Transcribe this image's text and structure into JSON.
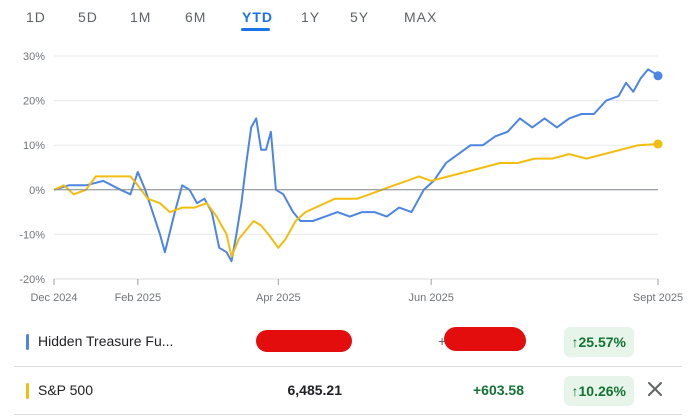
{
  "range_tabs": [
    "1D",
    "5D",
    "1M",
    "6M",
    "YTD",
    "1Y",
    "5Y",
    "MAX"
  ],
  "active_tab": "YTD",
  "colors": {
    "fund": "#4c85e6",
    "sp500": "#f3bd0e",
    "accent": "#1a73e8",
    "gain": "#137333",
    "gain_bg": "#e6f4ea",
    "redaction": "#e30d0d"
  },
  "chart_data": {
    "type": "line",
    "y_ticks": [
      "30%",
      "20%",
      "10%",
      "0%",
      "-10%",
      "-20%"
    ],
    "x_ticks": [
      "Dec 2024",
      "Feb 2025",
      "Apr 2025",
      "Jun 2025",
      "Sept 2025"
    ],
    "x_tick_dates": [
      "2024-12-31",
      "2025-02-03",
      "2025-04-01",
      "2025-06-02",
      "2025-09-02"
    ],
    "xlim": [
      "2024-12-31",
      "2025-09-02"
    ],
    "ylim": [
      -20,
      30
    ],
    "grid": "horizontal",
    "baseline": 0,
    "series": [
      {
        "name": "Hidden Treasure Fu...",
        "color_key": "fund",
        "points": [
          [
            "2024-12-31",
            0
          ],
          [
            "2025-01-06",
            1
          ],
          [
            "2025-01-13",
            1
          ],
          [
            "2025-01-20",
            2
          ],
          [
            "2025-01-27",
            0
          ],
          [
            "2025-01-31",
            -1
          ],
          [
            "2025-02-03",
            4
          ],
          [
            "2025-02-06",
            0
          ],
          [
            "2025-02-09",
            -5
          ],
          [
            "2025-02-12",
            -10
          ],
          [
            "2025-02-14",
            -14
          ],
          [
            "2025-02-18",
            -5
          ],
          [
            "2025-02-21",
            1
          ],
          [
            "2025-02-24",
            0
          ],
          [
            "2025-02-27",
            -3
          ],
          [
            "2025-03-02",
            -2
          ],
          [
            "2025-03-05",
            -5
          ],
          [
            "2025-03-08",
            -13
          ],
          [
            "2025-03-11",
            -14
          ],
          [
            "2025-03-13",
            -16
          ],
          [
            "2025-03-15",
            -10
          ],
          [
            "2025-03-17",
            -3
          ],
          [
            "2025-03-19",
            6
          ],
          [
            "2025-03-21",
            14
          ],
          [
            "2025-03-23",
            16
          ],
          [
            "2025-03-25",
            9
          ],
          [
            "2025-03-27",
            9
          ],
          [
            "2025-03-29",
            13
          ],
          [
            "2025-03-31",
            0
          ],
          [
            "2025-04-03",
            -1
          ],
          [
            "2025-04-07",
            -5
          ],
          [
            "2025-04-10",
            -7
          ],
          [
            "2025-04-15",
            -7
          ],
          [
            "2025-04-20",
            -6
          ],
          [
            "2025-04-25",
            -5
          ],
          [
            "2025-04-30",
            -6
          ],
          [
            "2025-05-05",
            -5
          ],
          [
            "2025-05-10",
            -5
          ],
          [
            "2025-05-15",
            -6
          ],
          [
            "2025-05-20",
            -4
          ],
          [
            "2025-05-25",
            -5
          ],
          [
            "2025-05-30",
            0
          ],
          [
            "2025-06-03",
            2
          ],
          [
            "2025-06-08",
            6
          ],
          [
            "2025-06-13",
            8
          ],
          [
            "2025-06-18",
            10
          ],
          [
            "2025-06-23",
            10
          ],
          [
            "2025-06-28",
            12
          ],
          [
            "2025-07-03",
            13
          ],
          [
            "2025-07-08",
            16
          ],
          [
            "2025-07-13",
            14
          ],
          [
            "2025-07-18",
            16
          ],
          [
            "2025-07-23",
            14
          ],
          [
            "2025-07-28",
            16
          ],
          [
            "2025-08-02",
            17
          ],
          [
            "2025-08-07",
            17
          ],
          [
            "2025-08-12",
            20
          ],
          [
            "2025-08-17",
            21
          ],
          [
            "2025-08-20",
            24
          ],
          [
            "2025-08-23",
            22
          ],
          [
            "2025-08-26",
            25
          ],
          [
            "2025-08-29",
            27
          ],
          [
            "2025-09-01",
            26
          ],
          [
            "2025-09-02",
            25.57
          ]
        ]
      },
      {
        "name": "S&P 500",
        "color_key": "sp500",
        "points": [
          [
            "2024-12-31",
            0
          ],
          [
            "2025-01-04",
            1
          ],
          [
            "2025-01-08",
            -1
          ],
          [
            "2025-01-13",
            0
          ],
          [
            "2025-01-17",
            3
          ],
          [
            "2025-01-22",
            3
          ],
          [
            "2025-01-27",
            3
          ],
          [
            "2025-01-31",
            3
          ],
          [
            "2025-02-03",
            1
          ],
          [
            "2025-02-07",
            -2
          ],
          [
            "2025-02-12",
            -3
          ],
          [
            "2025-02-16",
            -5
          ],
          [
            "2025-02-21",
            -4
          ],
          [
            "2025-02-26",
            -4
          ],
          [
            "2025-03-03",
            -3
          ],
          [
            "2025-03-07",
            -6
          ],
          [
            "2025-03-11",
            -10
          ],
          [
            "2025-03-13",
            -15
          ],
          [
            "2025-03-16",
            -11
          ],
          [
            "2025-03-19",
            -9
          ],
          [
            "2025-03-22",
            -7
          ],
          [
            "2025-03-25",
            -8
          ],
          [
            "2025-03-28",
            -10
          ],
          [
            "2025-04-01",
            -13
          ],
          [
            "2025-04-04",
            -11
          ],
          [
            "2025-04-08",
            -7
          ],
          [
            "2025-04-12",
            -5
          ],
          [
            "2025-04-16",
            -4
          ],
          [
            "2025-04-20",
            -3
          ],
          [
            "2025-04-24",
            -2
          ],
          [
            "2025-04-28",
            -2
          ],
          [
            "2025-05-03",
            -2
          ],
          [
            "2025-05-08",
            -1
          ],
          [
            "2025-05-13",
            0
          ],
          [
            "2025-05-18",
            1
          ],
          [
            "2025-05-23",
            2
          ],
          [
            "2025-05-28",
            3
          ],
          [
            "2025-06-02",
            2
          ],
          [
            "2025-06-09",
            3
          ],
          [
            "2025-06-16",
            4
          ],
          [
            "2025-06-23",
            5
          ],
          [
            "2025-06-30",
            6
          ],
          [
            "2025-07-07",
            6
          ],
          [
            "2025-07-14",
            7
          ],
          [
            "2025-07-21",
            7
          ],
          [
            "2025-07-28",
            8
          ],
          [
            "2025-08-04",
            7
          ],
          [
            "2025-08-11",
            8
          ],
          [
            "2025-08-18",
            9
          ],
          [
            "2025-08-25",
            10
          ],
          [
            "2025-09-02",
            10.26
          ]
        ]
      }
    ]
  },
  "rows": [
    {
      "name": "Hidden Treasure Fu...",
      "price": "",
      "change": "+",
      "pct": "25.57%",
      "color_key": "fund"
    },
    {
      "name": "S&P 500",
      "price": "6,485.21",
      "change": "+603.58",
      "pct": "10.26%",
      "color_key": "sp500"
    }
  ],
  "pct_arrow_icon": "arrow-up-icon",
  "close_icon": "close-icon"
}
